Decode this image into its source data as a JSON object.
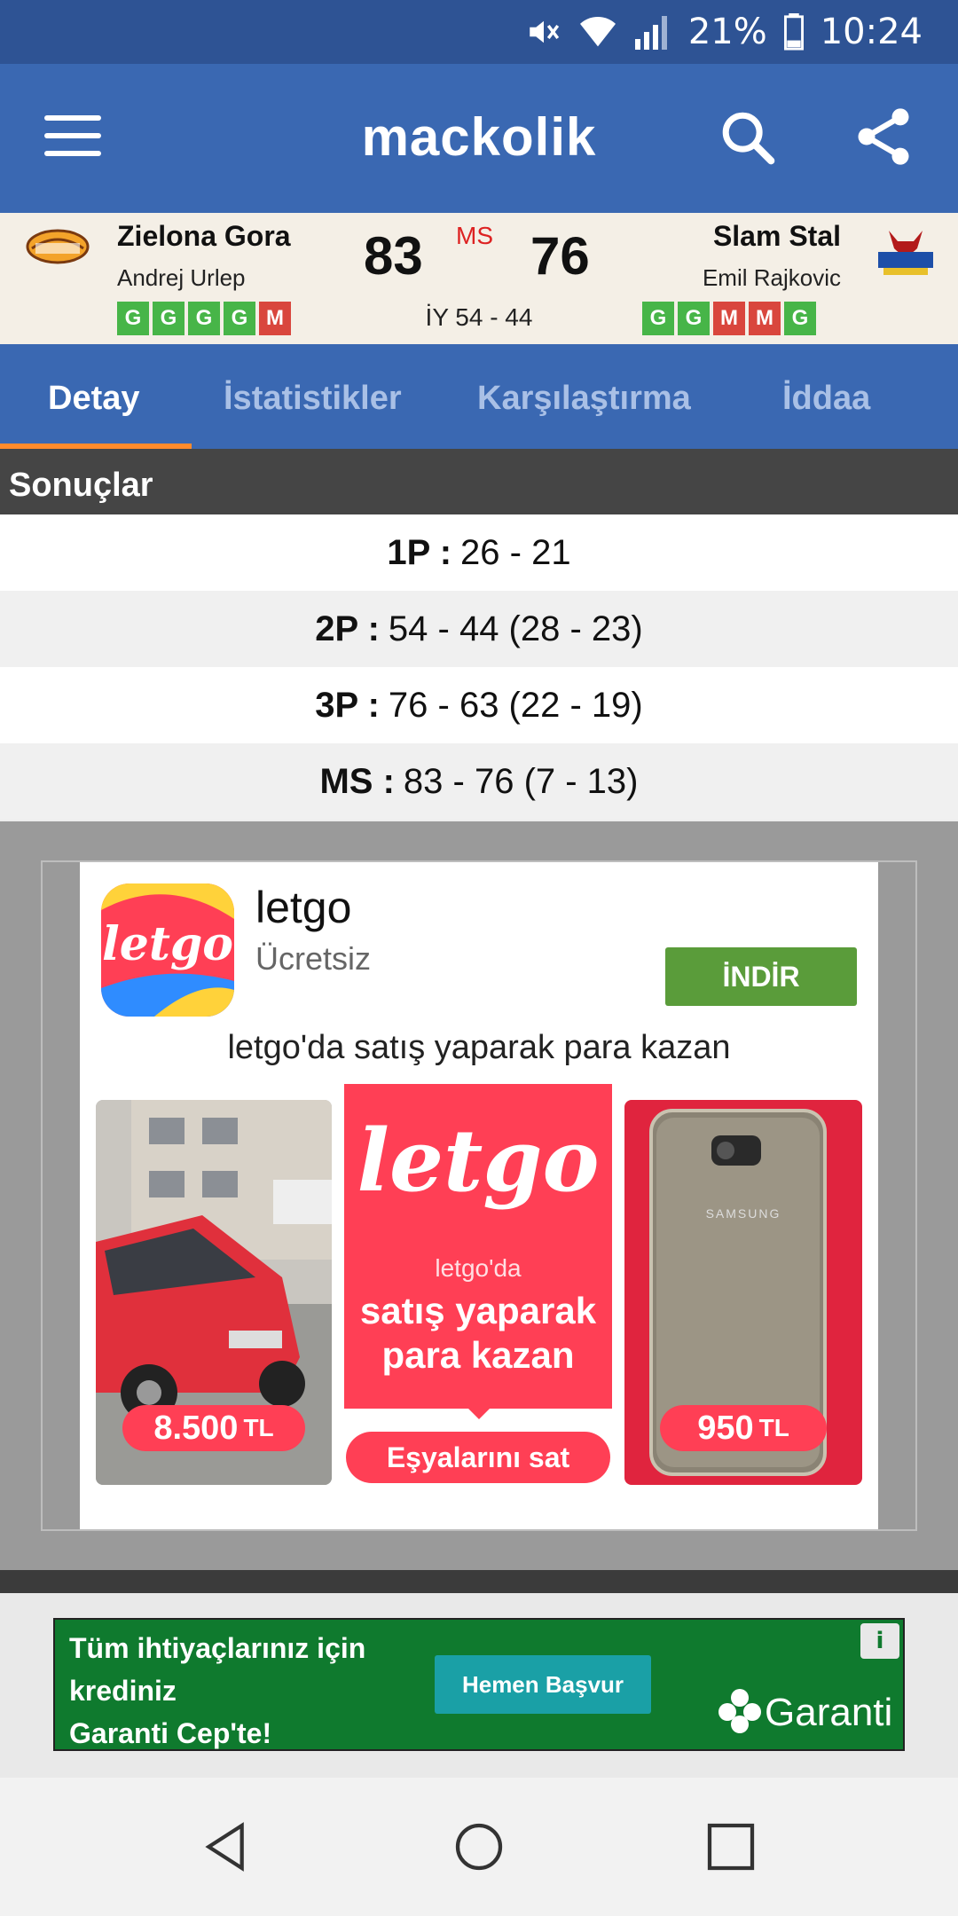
{
  "status_bar": {
    "battery": "21%",
    "time": "10:24"
  },
  "app_bar": {
    "title": "mackolik"
  },
  "match": {
    "home": {
      "name": "Zielona Gora",
      "coach": "Andrej Urlep",
      "form": [
        "G",
        "G",
        "G",
        "G",
        "M"
      ]
    },
    "away": {
      "name": "Slam Stal",
      "coach": "Emil Rajkovic",
      "form": [
        "G",
        "G",
        "M",
        "M",
        "G"
      ]
    },
    "score_home": "83",
    "score_away": "76",
    "status": "MS",
    "halftime": "İY 54 - 44"
  },
  "tabs": [
    "Detay",
    "İstatistikler",
    "Karşılaştırma",
    "İddaa"
  ],
  "results": {
    "title": "Sonuçlar",
    "rows": [
      {
        "label": "1P :",
        "value": "26 - 21"
      },
      {
        "label": "2P :",
        "value": "54 - 44 (28 - 23)"
      },
      {
        "label": "3P :",
        "value": "76 - 63 (22 - 19)"
      },
      {
        "label": "MS :",
        "value": "83 - 76 (7 - 13)"
      }
    ]
  },
  "ad": {
    "icon_text": "letgo",
    "app_name": "letgo",
    "price": "Ücretsiz",
    "install_label": "İNDİR",
    "tagline": "letgo'da satış yaparak para kazan",
    "promo_logo": "letgo",
    "promo_line1": "letgo'da",
    "promo_line2": "satış yaparak",
    "promo_line3": "para kazan",
    "promo_button": "Eşyalarını sat",
    "car_price": "8.500",
    "phone_price": "950",
    "currency": "TL",
    "phone_brand": "SAMSUNG"
  },
  "banner": {
    "line1": "Tüm ihtiyaçlarınız için",
    "line2": "krediniz",
    "line3": "Garanti Cep'te!",
    "button": "Hemen Başvur",
    "brand": "Garanti"
  },
  "colors": {
    "primary": "#3a68b2",
    "status_bar": "#2e5394",
    "accent": "#ff8b2c",
    "win": "#47b548",
    "loss": "#d9463d"
  }
}
